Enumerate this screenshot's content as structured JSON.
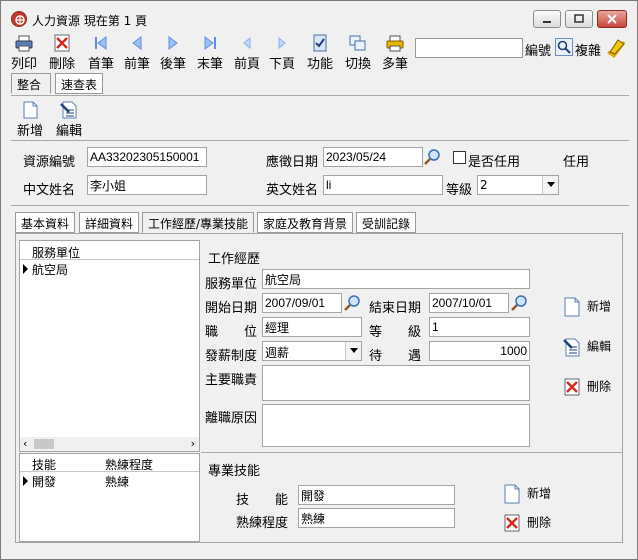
{
  "window": {
    "title": "人力資源  現在第 1 頁"
  },
  "toolbar": {
    "items": [
      {
        "label": "列印",
        "icon": "printer-icon"
      },
      {
        "label": "刪除",
        "icon": "delete-icon"
      },
      {
        "label": "首筆",
        "icon": "first-record-icon"
      },
      {
        "label": "前筆",
        "icon": "prev-record-icon"
      },
      {
        "label": "後筆",
        "icon": "next-record-icon"
      },
      {
        "label": "末筆",
        "icon": "last-record-icon"
      },
      {
        "label": "前頁",
        "icon": "prev-page-icon"
      },
      {
        "label": "下頁",
        "icon": "next-page-icon"
      },
      {
        "label": "功能",
        "icon": "function-icon"
      },
      {
        "label": "切換",
        "icon": "switch-icon"
      },
      {
        "label": "多筆",
        "icon": "multi-record-icon"
      }
    ],
    "search_value": "",
    "search_label": "編號",
    "copy_label": "複雜"
  },
  "view_tabs": [
    "整合",
    "速查表"
  ],
  "actions": {
    "new_label": "新增",
    "edit_label": "編輯"
  },
  "header_form": {
    "resource_id_label": "資源編號",
    "resource_id_value": "AA33202305150001",
    "apply_date_label": "應徵日期",
    "apply_date_value": "2023/05/24",
    "hired_label": "是否任用",
    "hired_status": "任用",
    "chinese_name_label": "中文姓名",
    "chinese_name_value": "李小姐",
    "english_name_label": "英文姓名",
    "english_name_value": "li",
    "grade_label": "等級",
    "grade_value": "2"
  },
  "detail_tabs": [
    "基本資料",
    "詳細資料",
    "工作經歷/專業技能",
    "家庭及教育背景",
    "受訓記錄"
  ],
  "work_grid": {
    "header": "服務單位",
    "rows": [
      "航空局"
    ]
  },
  "work_form": {
    "section_title": "工作經歷",
    "unit_label": "服務單位",
    "unit_value": "航空局",
    "start_label": "開始日期",
    "start_value": "2007/09/01",
    "end_label": "結束日期",
    "end_value": "2007/10/01",
    "position_label": "職　　位",
    "position_value": "經理",
    "level_label": "等　　級",
    "level_value": "1",
    "pay_label": "發薪制度",
    "pay_value": "週薪",
    "salary_label": "待　　遇",
    "salary_value": "1000",
    "duty_label": "主要職責",
    "duty_value": "",
    "reason_label": "離職原因",
    "reason_value": "",
    "new_label": "新增",
    "edit_label": "編輯",
    "delete_label": "刪除"
  },
  "skill_grid": {
    "headers": [
      "技能",
      "熟練程度"
    ],
    "rows": [
      [
        "開發",
        "熟練"
      ]
    ]
  },
  "skill_form": {
    "section_title": "專業技能",
    "skill_label": "技　　能",
    "skill_value": "開發",
    "level_label": "熟練程度",
    "level_value": "熟練",
    "new_label": "新增",
    "delete_label": "刪除"
  }
}
